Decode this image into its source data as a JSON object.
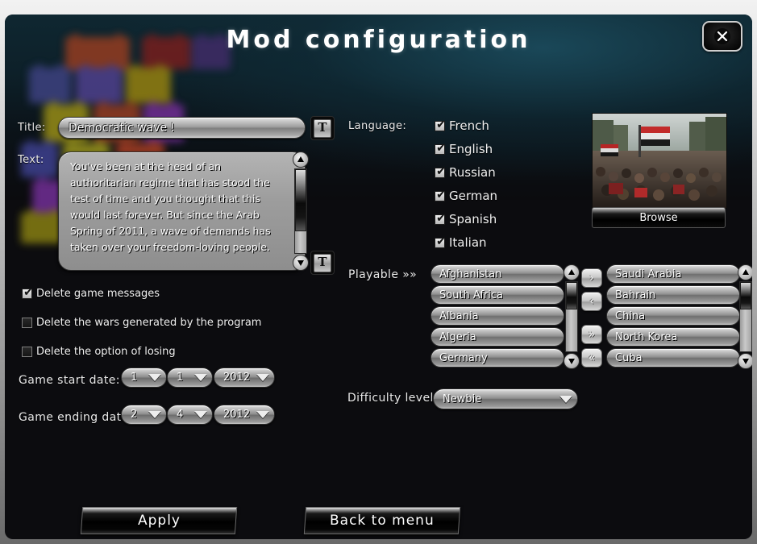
{
  "window": {
    "title": "Mod configuration",
    "close_icon": "close-x-icon"
  },
  "form": {
    "title_label": "Title:",
    "title_value": "Democratic wave !",
    "text_label": "Text:",
    "text_value": "You've been at the head of an authoritarian regime that has stood the test of time and you thought that this would last forever. But since the Arab Spring of 2011, a wave of demands has taken over your freedom-loving people.",
    "font_button_icon": "text-font-T-icon"
  },
  "language": {
    "label": "Language:",
    "options": [
      {
        "label": "French",
        "checked": true
      },
      {
        "label": "English",
        "checked": true
      },
      {
        "label": "Russian",
        "checked": true
      },
      {
        "label": "German",
        "checked": true
      },
      {
        "label": "Spanish",
        "checked": true
      },
      {
        "label": "Italian",
        "checked": true
      }
    ]
  },
  "options": [
    {
      "label": "Delete game messages",
      "checked": true
    },
    {
      "label": "Delete the wars generated by the program",
      "checked": false
    },
    {
      "label": "Delete the option of losing",
      "checked": false
    }
  ],
  "dates": {
    "start_label": "Game start date:",
    "start": {
      "day": "1",
      "month": "1",
      "year": "2012"
    },
    "end_label": "Game ending date:",
    "end": {
      "day": "2",
      "month": "4",
      "year": "2012"
    }
  },
  "playable": {
    "label": "Playable »»",
    "available": [
      "Afghanistan",
      "South Africa",
      "Albania",
      "Algeria",
      "Germany"
    ],
    "selected": [
      "Saudi Arabia",
      "Bahrain",
      "China",
      "North Korea",
      "Cuba"
    ],
    "buttons": {
      "move_right": "›",
      "move_left": "‹",
      "move_all_right": "»",
      "move_all_left": "«"
    }
  },
  "difficulty": {
    "label": "Difficulty level:",
    "value": "Newbie"
  },
  "preview": {
    "browse_label": "Browse",
    "image_alt": "crowd-protest-photo"
  },
  "actions": {
    "apply": "Apply",
    "back": "Back to menu"
  },
  "colors": {
    "panel_bg": "#0c0c0f",
    "teal_glow": "#1c4e60",
    "frame": "#bdbdbd",
    "text": "#ffffff"
  }
}
